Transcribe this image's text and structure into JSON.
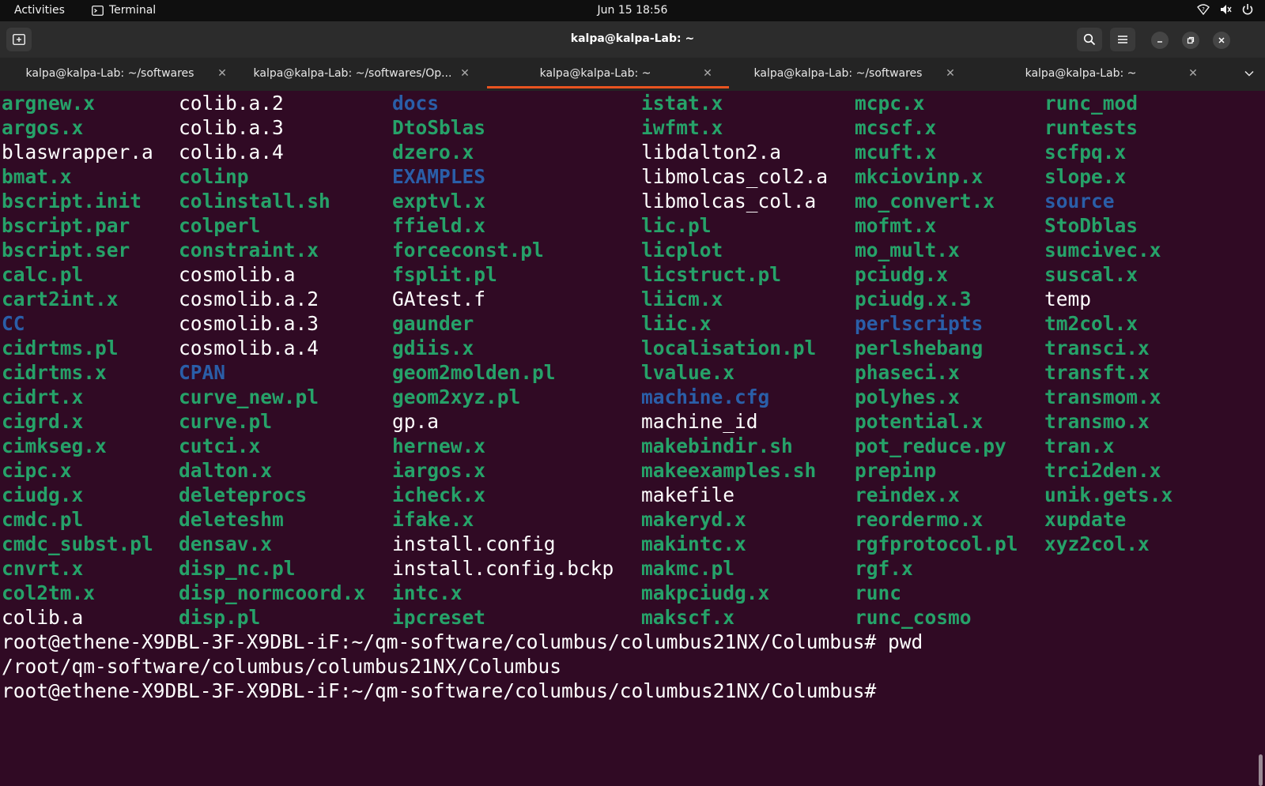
{
  "topbar": {
    "activities": "Activities",
    "app_name": "Terminal",
    "datetime": "Jun 15  18:56"
  },
  "headerbar": {
    "title": "kalpa@kalpa-Lab: ~"
  },
  "tabs": [
    {
      "label": "kalpa@kalpa-Lab: ~/softwares",
      "active": false
    },
    {
      "label": "kalpa@kalpa-Lab: ~/softwares/Op...",
      "active": false
    },
    {
      "label": "kalpa@kalpa-Lab: ~",
      "active": true
    },
    {
      "label": "kalpa@kalpa-Lab: ~/softwares",
      "active": false
    },
    {
      "label": "kalpa@kalpa-Lab: ~",
      "active": false
    }
  ],
  "colors": {
    "terminal_bg": "#300a24",
    "executable": "#26a269",
    "directory": "#2a5ea8",
    "plain_file": "#ffffff",
    "accent": "#e95420"
  },
  "listing": {
    "columns": [
      [
        {
          "name": "argnew.x",
          "type": "exec"
        },
        {
          "name": "argos.x",
          "type": "exec"
        },
        {
          "name": "blaswrapper.a",
          "type": "file"
        },
        {
          "name": "bmat.x",
          "type": "exec"
        },
        {
          "name": "bscript.init",
          "type": "exec"
        },
        {
          "name": "bscript.par",
          "type": "exec"
        },
        {
          "name": "bscript.ser",
          "type": "exec"
        },
        {
          "name": "calc.pl",
          "type": "exec"
        },
        {
          "name": "cart2int.x",
          "type": "exec"
        },
        {
          "name": "CC",
          "type": "dir"
        },
        {
          "name": "cidrtms.pl",
          "type": "exec"
        },
        {
          "name": "cidrtms.x",
          "type": "exec"
        },
        {
          "name": "cidrt.x",
          "type": "exec"
        },
        {
          "name": "cigrd.x",
          "type": "exec"
        },
        {
          "name": "cimkseg.x",
          "type": "exec"
        },
        {
          "name": "cipc.x",
          "type": "exec"
        },
        {
          "name": "ciudg.x",
          "type": "exec"
        },
        {
          "name": "cmdc.pl",
          "type": "exec"
        },
        {
          "name": "cmdc_subst.pl",
          "type": "exec"
        },
        {
          "name": "cnvrt.x",
          "type": "exec"
        },
        {
          "name": "col2tm.x",
          "type": "exec"
        },
        {
          "name": "colib.a",
          "type": "file"
        }
      ],
      [
        {
          "name": "colib.a.2",
          "type": "file"
        },
        {
          "name": "colib.a.3",
          "type": "file"
        },
        {
          "name": "colib.a.4",
          "type": "file"
        },
        {
          "name": "colinp",
          "type": "exec"
        },
        {
          "name": "colinstall.sh",
          "type": "exec"
        },
        {
          "name": "colperl",
          "type": "exec"
        },
        {
          "name": "constraint.x",
          "type": "exec"
        },
        {
          "name": "cosmolib.a",
          "type": "file"
        },
        {
          "name": "cosmolib.a.2",
          "type": "file"
        },
        {
          "name": "cosmolib.a.3",
          "type": "file"
        },
        {
          "name": "cosmolib.a.4",
          "type": "file"
        },
        {
          "name": "CPAN",
          "type": "dir"
        },
        {
          "name": "curve_new.pl",
          "type": "exec"
        },
        {
          "name": "curve.pl",
          "type": "exec"
        },
        {
          "name": "cutci.x",
          "type": "exec"
        },
        {
          "name": "dalton.x",
          "type": "exec"
        },
        {
          "name": "deleteprocs",
          "type": "exec"
        },
        {
          "name": "deleteshm",
          "type": "exec"
        },
        {
          "name": "densav.x",
          "type": "exec"
        },
        {
          "name": "disp_nc.pl",
          "type": "exec"
        },
        {
          "name": "disp_normcoord.x",
          "type": "exec"
        },
        {
          "name": "disp.pl",
          "type": "exec"
        }
      ],
      [
        {
          "name": "docs",
          "type": "dir"
        },
        {
          "name": "DtoSblas",
          "type": "exec"
        },
        {
          "name": "dzero.x",
          "type": "exec"
        },
        {
          "name": "EXAMPLES",
          "type": "dir"
        },
        {
          "name": "exptvl.x",
          "type": "exec"
        },
        {
          "name": "ffield.x",
          "type": "exec"
        },
        {
          "name": "forceconst.pl",
          "type": "exec"
        },
        {
          "name": "fsplit.pl",
          "type": "exec"
        },
        {
          "name": "GAtest.f",
          "type": "file"
        },
        {
          "name": "gaunder",
          "type": "exec"
        },
        {
          "name": "gdiis.x",
          "type": "exec"
        },
        {
          "name": "geom2molden.pl",
          "type": "exec"
        },
        {
          "name": "geom2xyz.pl",
          "type": "exec"
        },
        {
          "name": "gp.a",
          "type": "file"
        },
        {
          "name": "hernew.x",
          "type": "exec"
        },
        {
          "name": "iargos.x",
          "type": "exec"
        },
        {
          "name": "icheck.x",
          "type": "exec"
        },
        {
          "name": "ifake.x",
          "type": "exec"
        },
        {
          "name": "install.config",
          "type": "file"
        },
        {
          "name": "install.config.bckp",
          "type": "file"
        },
        {
          "name": "intc.x",
          "type": "exec"
        },
        {
          "name": "ipcreset",
          "type": "exec"
        }
      ],
      [
        {
          "name": "istat.x",
          "type": "exec"
        },
        {
          "name": "iwfmt.x",
          "type": "exec"
        },
        {
          "name": "libdalton2.a",
          "type": "file"
        },
        {
          "name": "libmolcas_col2.a",
          "type": "file"
        },
        {
          "name": "libmolcas_col.a",
          "type": "file"
        },
        {
          "name": "lic.pl",
          "type": "exec"
        },
        {
          "name": "licplot",
          "type": "exec"
        },
        {
          "name": "licstruct.pl",
          "type": "exec"
        },
        {
          "name": "liicm.x",
          "type": "exec"
        },
        {
          "name": "liic.x",
          "type": "exec"
        },
        {
          "name": "localisation.pl",
          "type": "exec"
        },
        {
          "name": "lvalue.x",
          "type": "exec"
        },
        {
          "name": "machine.cfg",
          "type": "dir"
        },
        {
          "name": "machine_id",
          "type": "file"
        },
        {
          "name": "makebindir.sh",
          "type": "exec"
        },
        {
          "name": "makeexamples.sh",
          "type": "exec"
        },
        {
          "name": "makefile",
          "type": "file"
        },
        {
          "name": "makeryd.x",
          "type": "exec"
        },
        {
          "name": "makintc.x",
          "type": "exec"
        },
        {
          "name": "makmc.pl",
          "type": "exec"
        },
        {
          "name": "makpciudg.x",
          "type": "exec"
        },
        {
          "name": "makscf.x",
          "type": "exec"
        }
      ],
      [
        {
          "name": "mcpc.x",
          "type": "exec"
        },
        {
          "name": "mcscf.x",
          "type": "exec"
        },
        {
          "name": "mcuft.x",
          "type": "exec"
        },
        {
          "name": "mkciovinp.x",
          "type": "exec"
        },
        {
          "name": "mo_convert.x",
          "type": "exec"
        },
        {
          "name": "mofmt.x",
          "type": "exec"
        },
        {
          "name": "mo_mult.x",
          "type": "exec"
        },
        {
          "name": "pciudg.x",
          "type": "exec"
        },
        {
          "name": "pciudg.x.3",
          "type": "exec"
        },
        {
          "name": "perlscripts",
          "type": "dir"
        },
        {
          "name": "perlshebang",
          "type": "exec"
        },
        {
          "name": "phaseci.x",
          "type": "exec"
        },
        {
          "name": "polyhes.x",
          "type": "exec"
        },
        {
          "name": "potential.x",
          "type": "exec"
        },
        {
          "name": "pot_reduce.py",
          "type": "exec"
        },
        {
          "name": "prepinp",
          "type": "exec"
        },
        {
          "name": "reindex.x",
          "type": "exec"
        },
        {
          "name": "reordermo.x",
          "type": "exec"
        },
        {
          "name": "rgfprotocol.pl",
          "type": "exec"
        },
        {
          "name": "rgf.x",
          "type": "exec"
        },
        {
          "name": "runc",
          "type": "exec"
        },
        {
          "name": "runc_cosmo",
          "type": "exec"
        }
      ],
      [
        {
          "name": "runc_mod",
          "type": "exec"
        },
        {
          "name": "runtests",
          "type": "exec"
        },
        {
          "name": "scfpq.x",
          "type": "exec"
        },
        {
          "name": "slope.x",
          "type": "exec"
        },
        {
          "name": "source",
          "type": "dir"
        },
        {
          "name": "StoDblas",
          "type": "exec"
        },
        {
          "name": "sumcivec.x",
          "type": "exec"
        },
        {
          "name": "suscal.x",
          "type": "exec"
        },
        {
          "name": "temp",
          "type": "file"
        },
        {
          "name": "tm2col.x",
          "type": "exec"
        },
        {
          "name": "transci.x",
          "type": "exec"
        },
        {
          "name": "transft.x",
          "type": "exec"
        },
        {
          "name": "transmom.x",
          "type": "exec"
        },
        {
          "name": "transmo.x",
          "type": "exec"
        },
        {
          "name": "tran.x",
          "type": "exec"
        },
        {
          "name": "trci2den.x",
          "type": "exec"
        },
        {
          "name": "unik.gets.x",
          "type": "exec"
        },
        {
          "name": "xupdate",
          "type": "exec"
        },
        {
          "name": "xyz2col.x",
          "type": "exec"
        }
      ]
    ]
  },
  "shell": {
    "lines": [
      "root@ethene-X9DBL-3F-X9DBL-iF:~/qm-software/columbus/columbus21NX/Columbus# pwd",
      "/root/qm-software/columbus/columbus21NX/Columbus",
      "root@ethene-X9DBL-3F-X9DBL-iF:~/qm-software/columbus/columbus21NX/Columbus# "
    ]
  }
}
